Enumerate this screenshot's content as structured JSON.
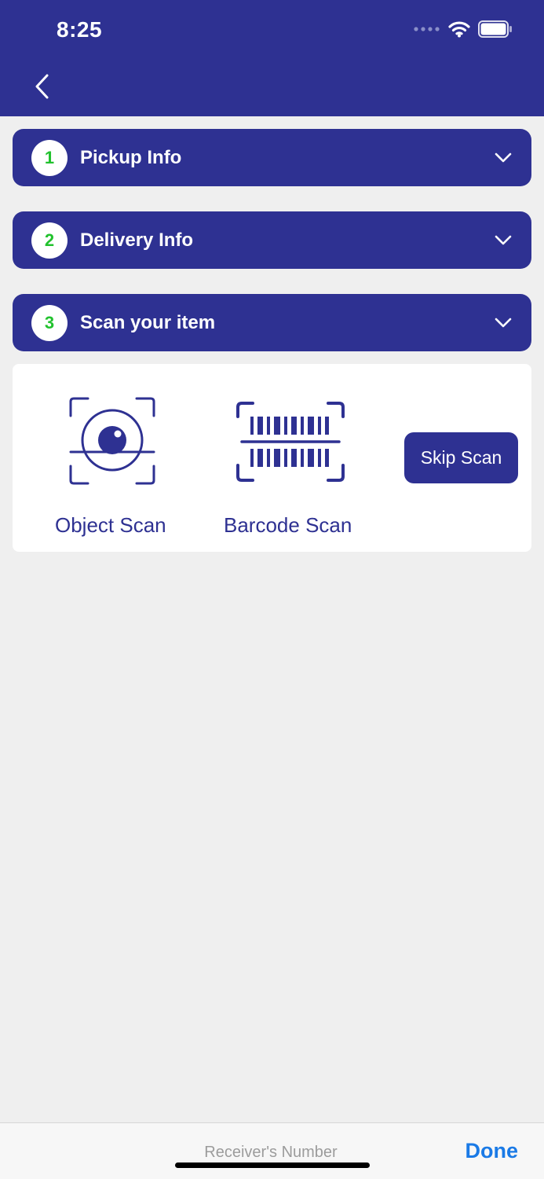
{
  "status_bar": {
    "time": "8:25"
  },
  "colors": {
    "brand": "#2e3192",
    "step_number": "#22c22e",
    "done": "#1a7ae6"
  },
  "sections": [
    {
      "number": "1",
      "label": "Pickup Info"
    },
    {
      "number": "2",
      "label": "Delivery Info"
    },
    {
      "number": "3",
      "label": "Scan your item"
    }
  ],
  "scan": {
    "object_label": "Object Scan",
    "barcode_label": "Barcode Scan",
    "skip_label": "Skip Scan"
  },
  "footer": {
    "receiver_placeholder": "Receiver's Number",
    "done_label": "Done"
  }
}
